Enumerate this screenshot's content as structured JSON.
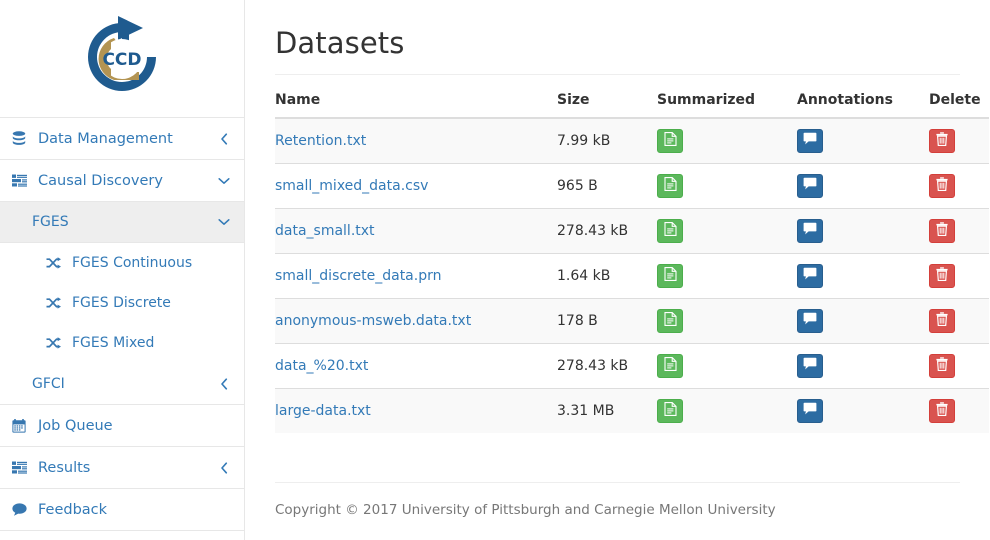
{
  "brand": {
    "logo_icon": "ccd-circular-arrow-logo",
    "logo_text": "CCD",
    "colors": {
      "blue": "#1f5b8f",
      "gold": "#b39452"
    }
  },
  "sidebar": {
    "items": [
      {
        "label": "Data Management",
        "icon": "database-icon",
        "caret": "chevron-left-icon",
        "level": 1,
        "active": false
      },
      {
        "label": "Causal Discovery",
        "icon": "tasks-icon",
        "caret": "chevron-down-icon",
        "level": 1,
        "active": false
      },
      {
        "label": "FGES",
        "icon": "",
        "caret": "chevron-down-icon",
        "level": 2,
        "active": true
      },
      {
        "label": "FGES Continuous",
        "icon": "shuffle-icon",
        "caret": "",
        "level": 3,
        "active": false
      },
      {
        "label": "FGES Discrete",
        "icon": "shuffle-icon",
        "caret": "",
        "level": 3,
        "active": false
      },
      {
        "label": "FGES Mixed",
        "icon": "shuffle-icon",
        "caret": "",
        "level": 3,
        "active": false
      },
      {
        "label": "GFCI",
        "icon": "",
        "caret": "chevron-left-icon",
        "level": 2,
        "active": false
      },
      {
        "label": "Job Queue",
        "icon": "calendar-icon",
        "caret": "",
        "level": 1,
        "active": false
      },
      {
        "label": "Results",
        "icon": "tasks-icon",
        "caret": "chevron-left-icon",
        "level": 1,
        "active": false
      },
      {
        "label": "Feedback",
        "icon": "comment-icon",
        "caret": "",
        "level": 1,
        "active": false
      }
    ]
  },
  "main": {
    "title": "Datasets",
    "table": {
      "columns": [
        "Name",
        "Size",
        "Summarized",
        "Annotations",
        "Delete"
      ],
      "rows": [
        {
          "name": "Retention.txt",
          "size": "7.99 kB",
          "summarized_icon": "file-text-icon",
          "annotations_icon": "comment-icon",
          "delete_icon": "trash-icon"
        },
        {
          "name": "small_mixed_data.csv",
          "size": "965 B",
          "summarized_icon": "file-text-icon",
          "annotations_icon": "comment-icon",
          "delete_icon": "trash-icon"
        },
        {
          "name": "data_small.txt",
          "size": "278.43 kB",
          "summarized_icon": "file-text-icon",
          "annotations_icon": "comment-icon",
          "delete_icon": "trash-icon"
        },
        {
          "name": "small_discrete_data.prn",
          "size": "1.64 kB",
          "summarized_icon": "file-text-icon",
          "annotations_icon": "comment-icon",
          "delete_icon": "trash-icon"
        },
        {
          "name": "anonymous-msweb.data.txt",
          "size": "178 B",
          "summarized_icon": "file-text-icon",
          "annotations_icon": "comment-icon",
          "delete_icon": "trash-icon"
        },
        {
          "name": "data_%20.txt",
          "size": "278.43 kB",
          "summarized_icon": "file-text-icon",
          "annotations_icon": "comment-icon",
          "delete_icon": "trash-icon"
        },
        {
          "name": "large-data.txt",
          "size": "3.31 MB",
          "summarized_icon": "file-text-icon",
          "annotations_icon": "comment-icon",
          "delete_icon": "trash-icon"
        }
      ]
    }
  },
  "footer": {
    "copyright": "Copyright © 2017 University of Pittsburgh and Carnegie Mellon University"
  },
  "colors": {
    "link": "#337ab7",
    "success": "#5cb85c",
    "primary": "#2d6ca2",
    "danger": "#d9534f"
  }
}
